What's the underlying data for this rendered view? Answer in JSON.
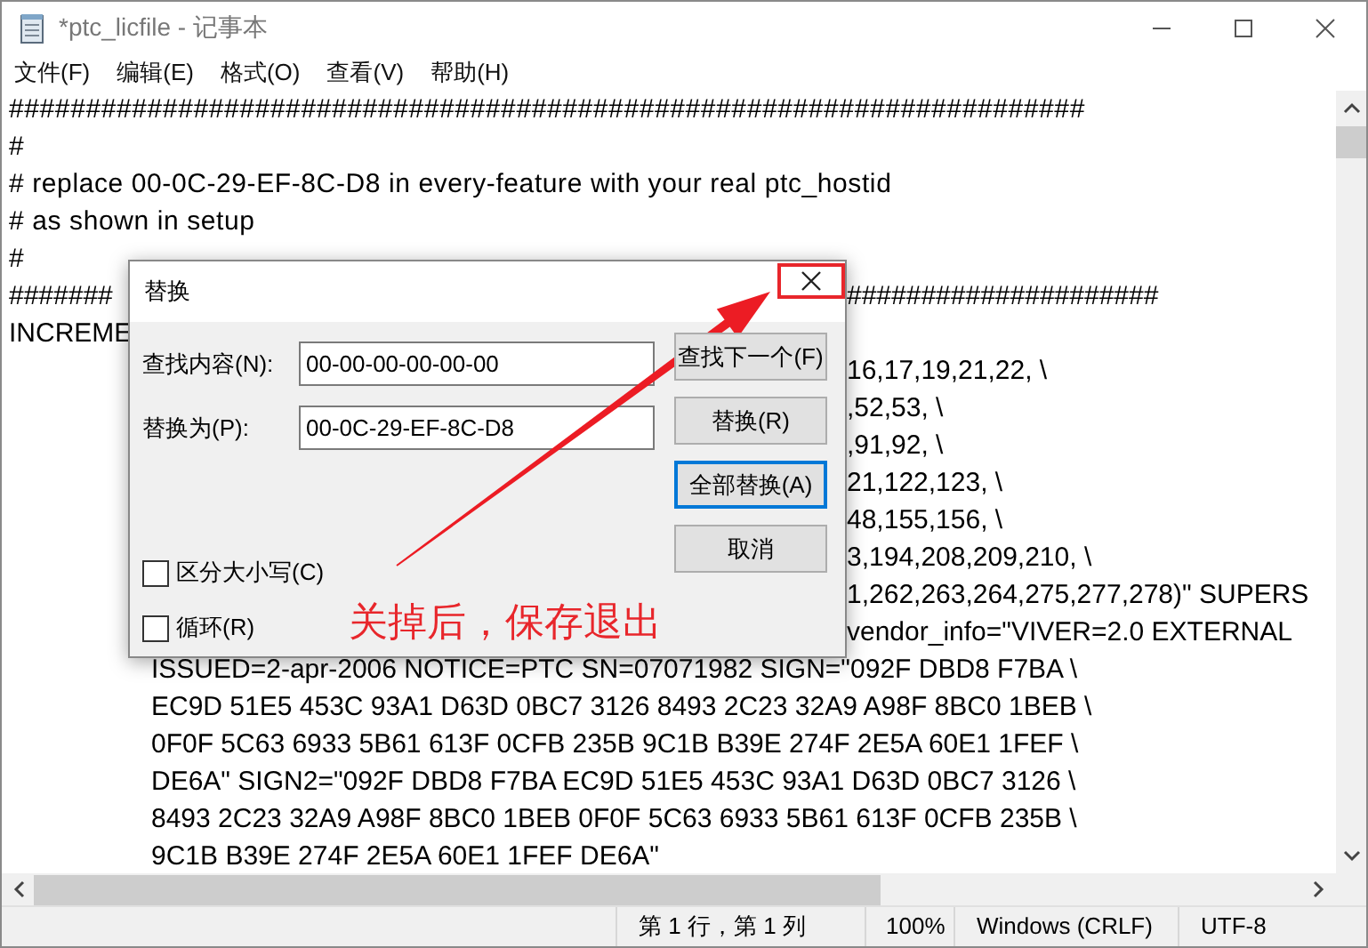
{
  "window": {
    "title": "*ptc_licfile - 记事本"
  },
  "menu": [
    "文件(F)",
    "编辑(E)",
    "格式(O)",
    "查看(V)",
    "帮助(H)"
  ],
  "editor": {
    "lines": [
      {
        "kind": "plain",
        "text": "######################################################################"
      },
      {
        "kind": "plain",
        "text": "#"
      },
      {
        "kind": "plain",
        "text": "# replace 00-0C-29-EF-8C-D8 in every-feature with your real ptc_hostid"
      },
      {
        "kind": "plain",
        "text": "# as shown in setup"
      },
      {
        "kind": "plain",
        "text": "#"
      },
      {
        "kind": "split",
        "head": "#######",
        "tail": "#####################"
      },
      {
        "kind": "split",
        "head": "INCREME"
      },
      {
        "kind": "split",
        "tail": "16,17,19,21,22, \\"
      },
      {
        "kind": "split",
        "tail": ",52,53, \\"
      },
      {
        "kind": "split",
        "tail": ",91,92, \\"
      },
      {
        "kind": "split",
        "tail": "21,122,123, \\"
      },
      {
        "kind": "split",
        "tail": "48,155,156, \\"
      },
      {
        "kind": "split",
        "tail": "3,194,208,209,210, \\"
      },
      {
        "kind": "split",
        "tail": "1,262,263,264,275,277,278)\" SUPERS"
      },
      {
        "kind": "split",
        "tail": "vendor_info=\"VIVER=2.0 EXTERNAL"
      },
      {
        "kind": "indented",
        "text": "ISSUED=2-apr-2006 NOTICE=PTC SN=07071982 SIGN=\"092F DBD8 F7BA \\"
      },
      {
        "kind": "indented",
        "text": "EC9D 51E5 453C 93A1 D63D 0BC7 3126 8493 2C23 32A9 A98F 8BC0 1BEB \\"
      },
      {
        "kind": "indented",
        "text": "0F0F 5C63 6933 5B61 613F 0CFB 235B 9C1B B39E 274F 2E5A 60E1 1FEF \\"
      },
      {
        "kind": "indented",
        "text": "DE6A\" SIGN2=\"092F DBD8 F7BA EC9D 51E5 453C 93A1 D63D 0BC7 3126 \\"
      },
      {
        "kind": "indented",
        "text": "8493 2C23 32A9 A98F 8BC0 1BEB 0F0F 5C63 6933 5B61 613F 0CFB 235B \\"
      },
      {
        "kind": "indented",
        "text": "9C1B B39E 274F 2E5A 60E1 1FEF DE6A\""
      }
    ]
  },
  "dialog": {
    "title": "替换",
    "fields": [
      {
        "label": "查找内容(N):",
        "value": "00-00-00-00-00-00"
      },
      {
        "label": "替换为(P):",
        "value": "00-0C-29-EF-8C-D8"
      }
    ],
    "buttons": [
      {
        "label": "查找下一个(F)",
        "default": false
      },
      {
        "label": "替换(R)",
        "default": false
      },
      {
        "label": "全部替换(A)",
        "default": true
      },
      {
        "label": "取消",
        "default": false
      }
    ],
    "options": [
      {
        "label": "区分大小写(C)",
        "checked": false
      },
      {
        "label": "循环(R)",
        "checked": false
      }
    ]
  },
  "annotation": {
    "note": "关掉后，保存退出"
  },
  "status_bar": [
    "第 1 行，第 1 列",
    "100%",
    "Windows (CRLF)",
    "UTF-8"
  ]
}
